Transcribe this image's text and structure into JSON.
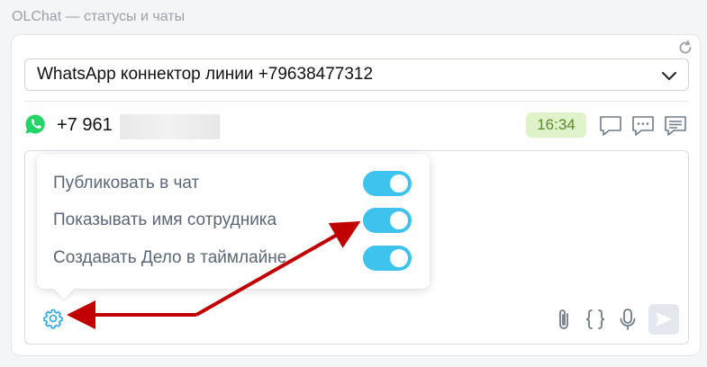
{
  "page": {
    "title": "OLChat — статусы и чаты"
  },
  "connector": {
    "selected": "WhatsApp коннектор линии +79638477312"
  },
  "contact": {
    "phone": "+7 961",
    "time": "16:34"
  },
  "settings": {
    "options": [
      {
        "label": "Публиковать в чат",
        "enabled": true
      },
      {
        "label": "Показывать имя сотрудника",
        "enabled": true
      },
      {
        "label": "Создавать Дело в таймлайне",
        "enabled": true
      }
    ]
  },
  "colors": {
    "accent": "#3ec3ee",
    "whatsapp": "#25d366",
    "time_badge_bg": "#dff2c9",
    "annotation_arrow": "#c00000"
  },
  "icons": {
    "refresh": "refresh-icon",
    "dropdown": "chevron-down-icon",
    "messenger": "whatsapp-icon",
    "chat_actions": [
      "chat-bubble-icon",
      "chat-dots-icon",
      "chat-lines-icon"
    ],
    "tools": [
      "gear-icon",
      "paperclip-icon",
      "code-braces-icon",
      "microphone-icon",
      "send-icon"
    ]
  }
}
